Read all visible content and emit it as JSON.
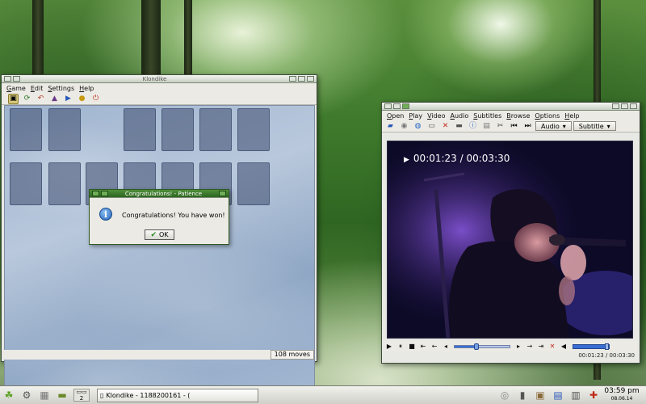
{
  "klondike": {
    "title": "Klondike",
    "menu": [
      "Game",
      "Edit",
      "Settings",
      "Help"
    ],
    "toolbar_icons": [
      "new-game-icon",
      "restart-icon",
      "undo-icon",
      "hint-icon",
      "redeal-icon",
      "demo-icon",
      "quit-icon"
    ],
    "moves": "108 moves"
  },
  "dialog": {
    "title": "Congratulations! - Patience",
    "message": "Congratulations! You have won!",
    "ok_label": "OK"
  },
  "player": {
    "menu": [
      "Open",
      "Play",
      "Video",
      "Audio",
      "Subtitles",
      "Browse",
      "Options",
      "Help"
    ],
    "audio_label": "Audio",
    "subtitle_label": "Subtitle",
    "osd_time": "00:01:23 / 00:03:30",
    "time_display": "00:01:23 / 00:03:30",
    "progress": 0.395,
    "volume": 0.95
  },
  "taskbar": {
    "desktop_number": "2",
    "task_label": "Klondike - 1188200161 - (",
    "clock_time": "03:59 pm",
    "clock_date": "08.06.14"
  }
}
